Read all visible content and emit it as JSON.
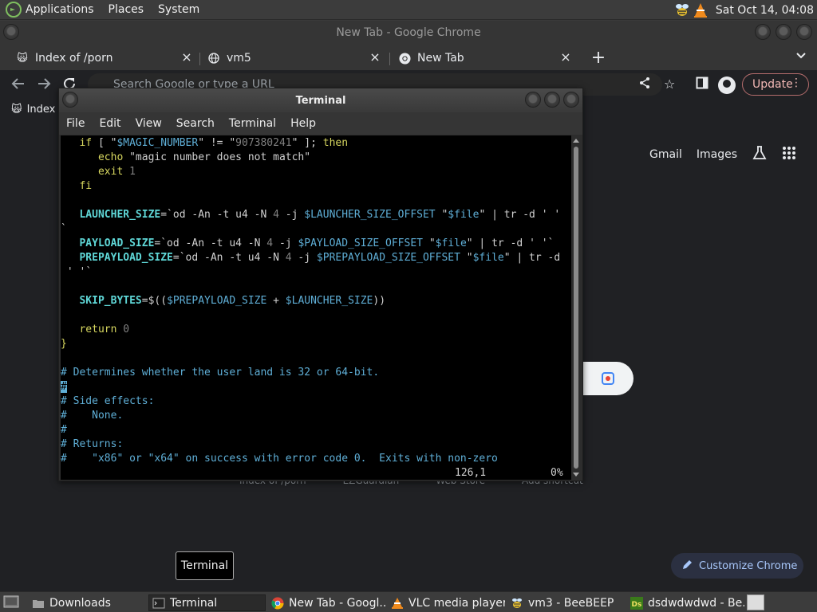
{
  "top_panel": {
    "menus": [
      "Applications",
      "Places",
      "System"
    ],
    "clock": "Sat Oct 14, 04:08"
  },
  "chrome": {
    "window_title": "New Tab - Google Chrome",
    "tabs": [
      {
        "label": "Index of /porn"
      },
      {
        "label": "vm5"
      },
      {
        "label": "New Tab"
      }
    ],
    "omnibox_placeholder": "Search Google or type a URL",
    "update_label": "Update",
    "bookmark_label": "Index",
    "ntp": {
      "gmail": "Gmail",
      "images": "Images",
      "shortcuts": [
        "Index of /porn",
        "EZGuardian",
        "Web Store",
        "Add shortcut"
      ],
      "customize_label": "Customize Chrome"
    }
  },
  "terminal": {
    "title": "Terminal",
    "menus": [
      "File",
      "Edit",
      "View",
      "Search",
      "Terminal",
      "Help"
    ],
    "status": {
      "position": "126,1",
      "percent": "0%"
    }
  },
  "tooltip": "Terminal",
  "taskbar": [
    {
      "label": "Downloads"
    },
    {
      "label": "Terminal"
    },
    {
      "label": "New Tab - Googl..."
    },
    {
      "label": "VLC media player"
    },
    {
      "label": "vm3 - BeeBEEP"
    },
    {
      "label": "dsdwdwdwd - Be..."
    }
  ],
  "colors": {
    "terminal_bg": "#000000",
    "keyword": "#d7d75f",
    "identifier": "#5fd7d7",
    "comment": "#5fafd7",
    "update_accent": "#f2b8b5"
  }
}
